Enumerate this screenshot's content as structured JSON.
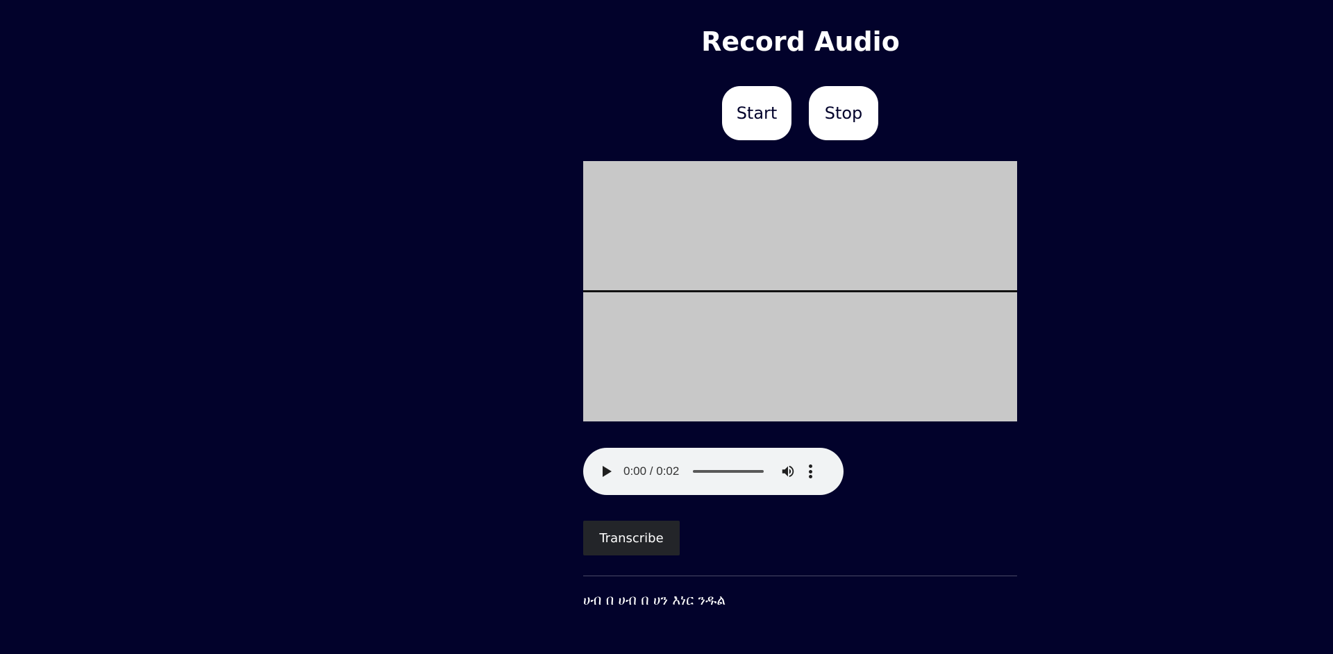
{
  "page": {
    "title": "Record Audio"
  },
  "controls": {
    "start_label": "Start",
    "stop_label": "Stop"
  },
  "audio_player": {
    "time_display": "0:00 / 0:02",
    "progress_fraction": 0,
    "icons": [
      "play-icon",
      "volume-icon",
      "more-options-icon"
    ]
  },
  "actions": {
    "transcribe_label": "Transcribe"
  },
  "result": {
    "transcript": "ሀብ በ ሀብ በ ሀን እነር ንዱል"
  },
  "colors": {
    "background": "#02022b",
    "waveform_bg": "#c8c8c8",
    "button_bg": "#ffffff",
    "transcribe_bg": "#232529"
  }
}
